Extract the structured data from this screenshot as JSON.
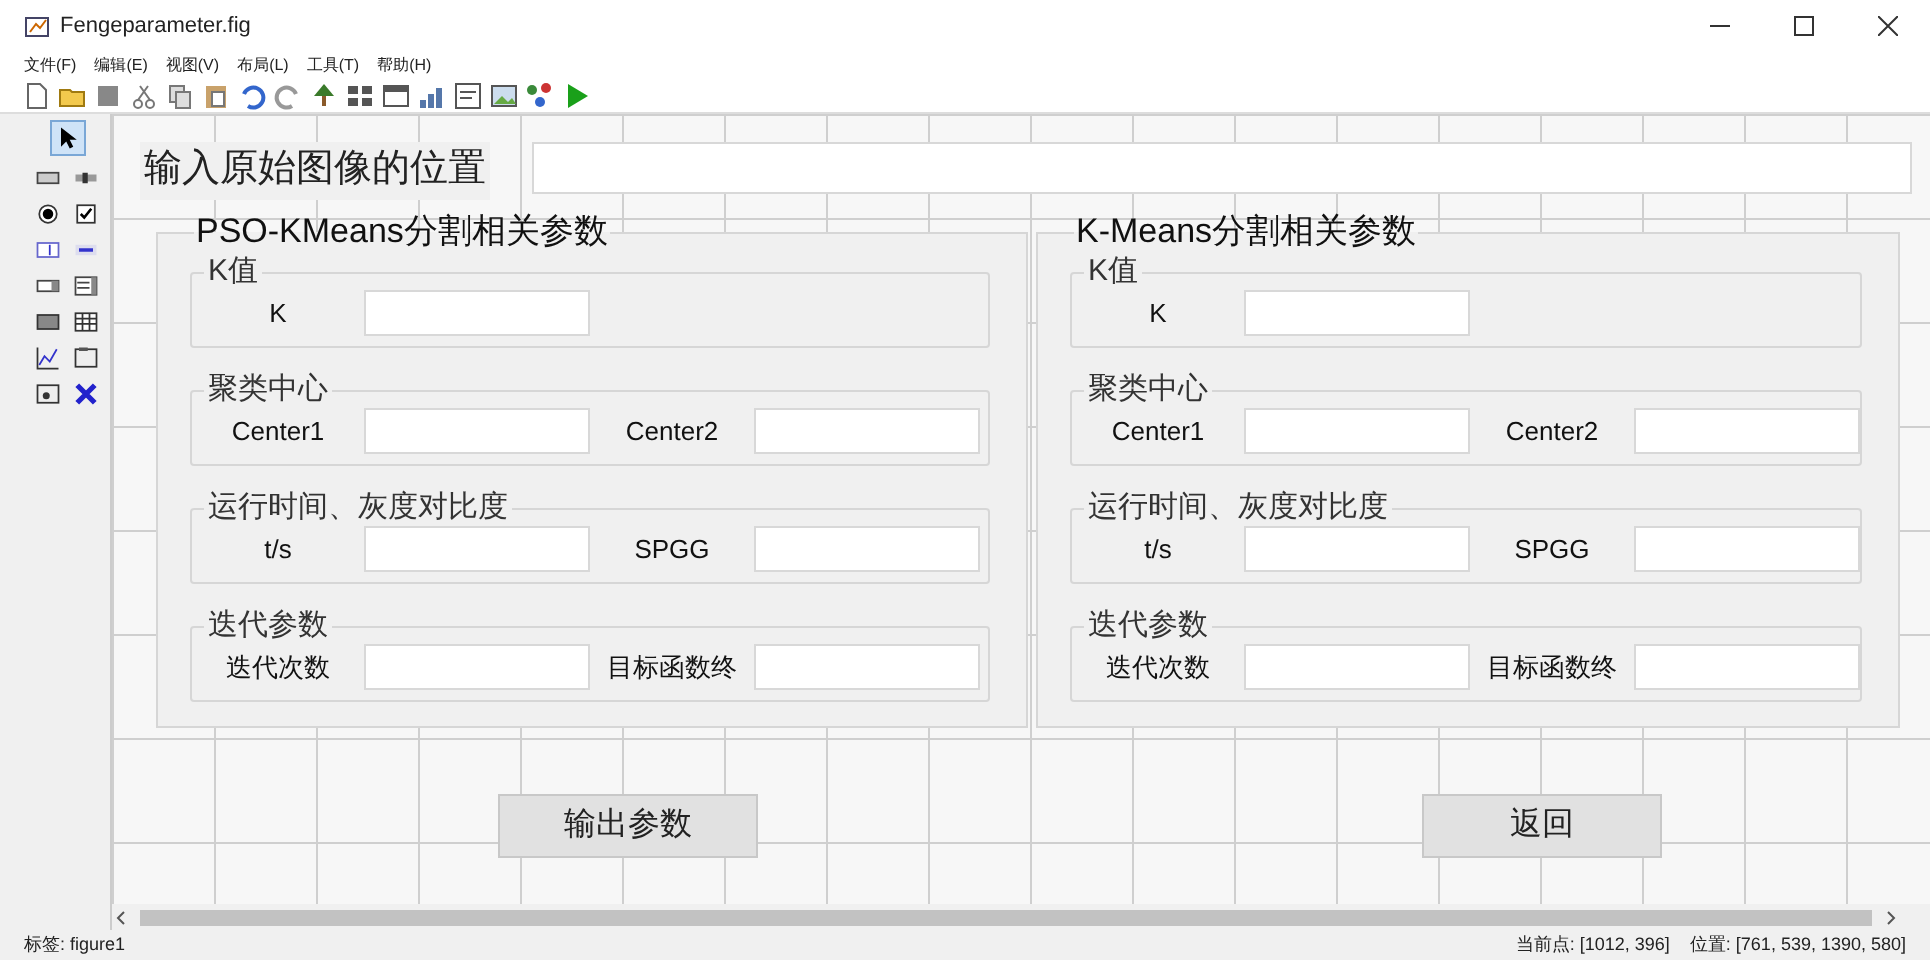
{
  "window": {
    "title": "Fengeparameter.fig"
  },
  "menu": [
    "文件(F)",
    "编辑(E)",
    "视图(V)",
    "布局(L)",
    "工具(T)",
    "帮助(H)"
  ],
  "palette": [
    {
      "kind": "pointer",
      "selected": true
    },
    {
      "kind": "pushbutton",
      "selected": false
    },
    {
      "kind": "slider",
      "selected": false
    },
    {
      "kind": "radio",
      "selected": false
    },
    {
      "kind": "checkbox",
      "selected": false
    },
    {
      "kind": "edit",
      "selected": false
    },
    {
      "kind": "text",
      "selected": false
    },
    {
      "kind": "popup",
      "selected": false
    },
    {
      "kind": "listbox",
      "selected": false
    },
    {
      "kind": "toggle",
      "selected": false
    },
    {
      "kind": "table",
      "selected": false
    },
    {
      "kind": "axes",
      "selected": false
    },
    {
      "kind": "panel",
      "selected": false
    },
    {
      "kind": "buttongroup",
      "selected": false
    },
    {
      "kind": "activex",
      "selected": false
    }
  ],
  "path_label": "输入原始图像的位置",
  "panels": [
    {
      "title": "PSO-KMeans分割相关参数",
      "groups": [
        {
          "title": "K值",
          "fields": [
            "K"
          ]
        },
        {
          "title": "聚类中心",
          "fields": [
            "Center1",
            "Center2"
          ]
        },
        {
          "title": "运行时间、灰度对比度",
          "fields": [
            "t/s",
            "SPGG"
          ]
        },
        {
          "title": "迭代参数",
          "fields": [
            "迭代次数",
            "目标函数终"
          ]
        }
      ]
    },
    {
      "title": "K-Means分割相关参数",
      "groups": [
        {
          "title": "K值",
          "fields": [
            "K"
          ]
        },
        {
          "title": "聚类中心",
          "fields": [
            "Center1",
            "Center2"
          ]
        },
        {
          "title": "运行时间、灰度对比度",
          "fields": [
            "t/s",
            "SPGG"
          ]
        },
        {
          "title": "迭代参数",
          "fields": [
            "迭代次数",
            "目标函数终"
          ]
        }
      ]
    }
  ],
  "buttons": [
    "输出参数",
    "返回"
  ],
  "status_bar": {
    "tag": "标签: figure1",
    "current_point": "当前点: [1012, 396]",
    "position": "位置: [761, 539, 1390, 580]"
  }
}
